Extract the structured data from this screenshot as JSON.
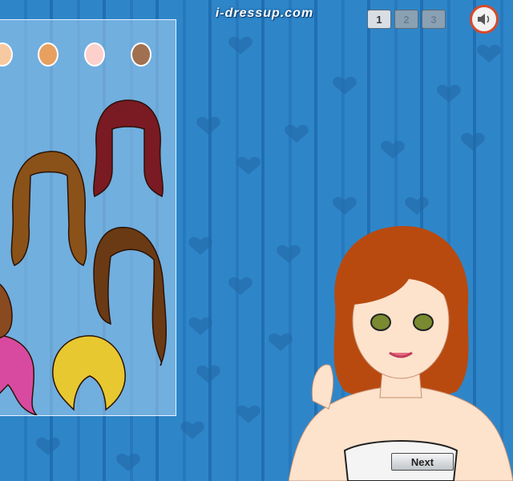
{
  "logo": {
    "text": "i-dressup.com"
  },
  "pager": {
    "pages": [
      "1",
      "2",
      "3"
    ],
    "active_index": 0
  },
  "sound": {
    "icon": "speaker-icon"
  },
  "panel": {
    "skin_swatches": [
      "#f6c9a0",
      "#e8a060",
      "#fdd0cc",
      "#a07050"
    ],
    "hair_colors": [
      "#7a1a22",
      "#8a5218",
      "#6a3a14",
      "#d84aa0",
      "#e8c830",
      "#8a4a20"
    ]
  },
  "model": {
    "hair_color": "#b84a10",
    "skin_color": "#fde2cc",
    "eye_color": "#7a8a30"
  },
  "next": {
    "label": "Next"
  }
}
